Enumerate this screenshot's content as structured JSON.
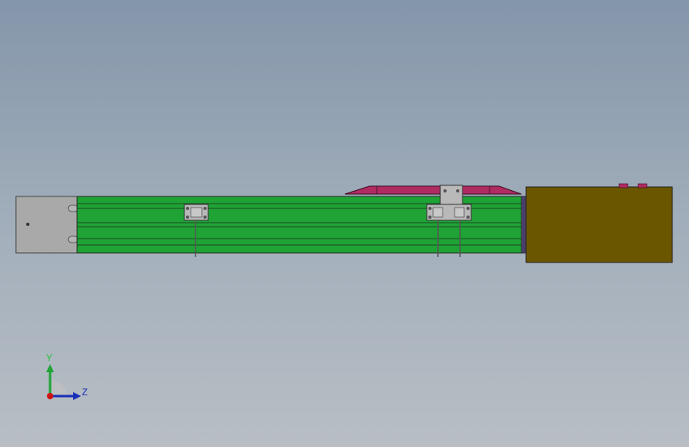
{
  "viewport": {
    "colors": {
      "background_top": "#8496aa",
      "background_bottom": "#b8bec4",
      "rail_green": "#1fa335",
      "end_cap_grey": "#a9a9a9",
      "motor_olive": "#6b5600",
      "carriage_magenta": "#b02b62",
      "bracket_grey": "#b9b9b9"
    },
    "model": {
      "parts": [
        "end-cap",
        "linear-rail",
        "carriage-top-plate",
        "mounting-bracket",
        "motor-housing"
      ]
    }
  },
  "triad": {
    "y_label": "Y",
    "z_label": "Z",
    "x_icon": "red-dot-icon",
    "y_icon": "green-arrow-icon",
    "z_icon": "blue-arrow-icon"
  }
}
